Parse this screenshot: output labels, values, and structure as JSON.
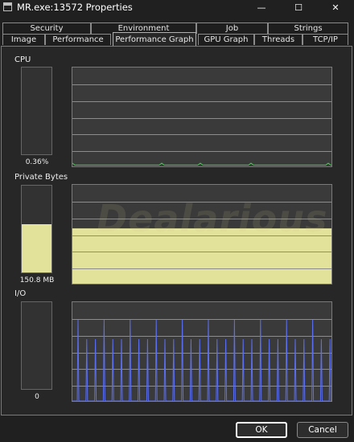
{
  "window": {
    "title": "MR.exe:13572 Properties",
    "minimize_label": "—",
    "maximize_label": "☐",
    "close_label": "✕"
  },
  "tabs": {
    "row_back": [
      {
        "label": "Security"
      },
      {
        "label": "Environment"
      },
      {
        "label": "Job"
      },
      {
        "label": "Strings"
      }
    ],
    "row_front": [
      {
        "label": "Image"
      },
      {
        "label": "Performance"
      },
      {
        "label": "Performance Graph",
        "active": true
      },
      {
        "label": "GPU Graph"
      },
      {
        "label": "Threads"
      },
      {
        "label": "TCP/IP"
      }
    ]
  },
  "cpu": {
    "label": "CPU",
    "value_text": "0.36%",
    "fill_fraction": 0.0036,
    "line_color": "#3fd14a"
  },
  "private_bytes": {
    "label": "Private Bytes",
    "value_text": "150.8 MB",
    "fill_fraction": 0.56,
    "fill_color": "#e2e29a",
    "line_color": "#f0f0a0"
  },
  "io": {
    "label": "I/O",
    "value_text": "0",
    "fill_fraction": 0,
    "line_color": "#5b6ff0"
  },
  "watermark": "Dealarious",
  "buttons": {
    "ok_label": "OK",
    "cancel_label": "Cancel"
  }
}
